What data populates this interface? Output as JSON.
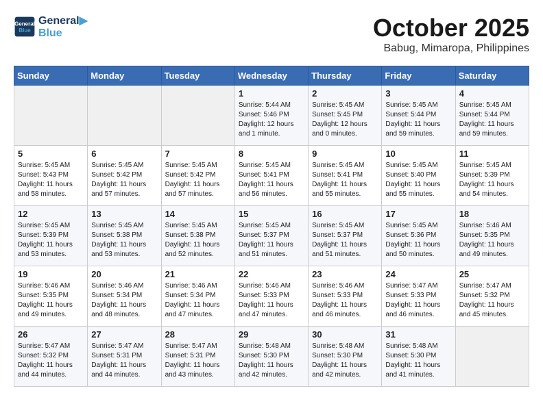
{
  "header": {
    "logo_line1": "General",
    "logo_line2": "Blue",
    "month": "October 2025",
    "location": "Babug, Mimaropa, Philippines"
  },
  "days_of_week": [
    "Sunday",
    "Monday",
    "Tuesday",
    "Wednesday",
    "Thursday",
    "Friday",
    "Saturday"
  ],
  "weeks": [
    [
      {
        "day": "",
        "text": ""
      },
      {
        "day": "",
        "text": ""
      },
      {
        "day": "",
        "text": ""
      },
      {
        "day": "1",
        "text": "Sunrise: 5:44 AM\nSunset: 5:46 PM\nDaylight: 12 hours\nand 1 minute."
      },
      {
        "day": "2",
        "text": "Sunrise: 5:45 AM\nSunset: 5:45 PM\nDaylight: 12 hours\nand 0 minutes."
      },
      {
        "day": "3",
        "text": "Sunrise: 5:45 AM\nSunset: 5:44 PM\nDaylight: 11 hours\nand 59 minutes."
      },
      {
        "day": "4",
        "text": "Sunrise: 5:45 AM\nSunset: 5:44 PM\nDaylight: 11 hours\nand 59 minutes."
      }
    ],
    [
      {
        "day": "5",
        "text": "Sunrise: 5:45 AM\nSunset: 5:43 PM\nDaylight: 11 hours\nand 58 minutes."
      },
      {
        "day": "6",
        "text": "Sunrise: 5:45 AM\nSunset: 5:42 PM\nDaylight: 11 hours\nand 57 minutes."
      },
      {
        "day": "7",
        "text": "Sunrise: 5:45 AM\nSunset: 5:42 PM\nDaylight: 11 hours\nand 57 minutes."
      },
      {
        "day": "8",
        "text": "Sunrise: 5:45 AM\nSunset: 5:41 PM\nDaylight: 11 hours\nand 56 minutes."
      },
      {
        "day": "9",
        "text": "Sunrise: 5:45 AM\nSunset: 5:41 PM\nDaylight: 11 hours\nand 55 minutes."
      },
      {
        "day": "10",
        "text": "Sunrise: 5:45 AM\nSunset: 5:40 PM\nDaylight: 11 hours\nand 55 minutes."
      },
      {
        "day": "11",
        "text": "Sunrise: 5:45 AM\nSunset: 5:39 PM\nDaylight: 11 hours\nand 54 minutes."
      }
    ],
    [
      {
        "day": "12",
        "text": "Sunrise: 5:45 AM\nSunset: 5:39 PM\nDaylight: 11 hours\nand 53 minutes."
      },
      {
        "day": "13",
        "text": "Sunrise: 5:45 AM\nSunset: 5:38 PM\nDaylight: 11 hours\nand 53 minutes."
      },
      {
        "day": "14",
        "text": "Sunrise: 5:45 AM\nSunset: 5:38 PM\nDaylight: 11 hours\nand 52 minutes."
      },
      {
        "day": "15",
        "text": "Sunrise: 5:45 AM\nSunset: 5:37 PM\nDaylight: 11 hours\nand 51 minutes."
      },
      {
        "day": "16",
        "text": "Sunrise: 5:45 AM\nSunset: 5:37 PM\nDaylight: 11 hours\nand 51 minutes."
      },
      {
        "day": "17",
        "text": "Sunrise: 5:45 AM\nSunset: 5:36 PM\nDaylight: 11 hours\nand 50 minutes."
      },
      {
        "day": "18",
        "text": "Sunrise: 5:46 AM\nSunset: 5:35 PM\nDaylight: 11 hours\nand 49 minutes."
      }
    ],
    [
      {
        "day": "19",
        "text": "Sunrise: 5:46 AM\nSunset: 5:35 PM\nDaylight: 11 hours\nand 49 minutes."
      },
      {
        "day": "20",
        "text": "Sunrise: 5:46 AM\nSunset: 5:34 PM\nDaylight: 11 hours\nand 48 minutes."
      },
      {
        "day": "21",
        "text": "Sunrise: 5:46 AM\nSunset: 5:34 PM\nDaylight: 11 hours\nand 47 minutes."
      },
      {
        "day": "22",
        "text": "Sunrise: 5:46 AM\nSunset: 5:33 PM\nDaylight: 11 hours\nand 47 minutes."
      },
      {
        "day": "23",
        "text": "Sunrise: 5:46 AM\nSunset: 5:33 PM\nDaylight: 11 hours\nand 46 minutes."
      },
      {
        "day": "24",
        "text": "Sunrise: 5:47 AM\nSunset: 5:33 PM\nDaylight: 11 hours\nand 46 minutes."
      },
      {
        "day": "25",
        "text": "Sunrise: 5:47 AM\nSunset: 5:32 PM\nDaylight: 11 hours\nand 45 minutes."
      }
    ],
    [
      {
        "day": "26",
        "text": "Sunrise: 5:47 AM\nSunset: 5:32 PM\nDaylight: 11 hours\nand 44 minutes."
      },
      {
        "day": "27",
        "text": "Sunrise: 5:47 AM\nSunset: 5:31 PM\nDaylight: 11 hours\nand 44 minutes."
      },
      {
        "day": "28",
        "text": "Sunrise: 5:47 AM\nSunset: 5:31 PM\nDaylight: 11 hours\nand 43 minutes."
      },
      {
        "day": "29",
        "text": "Sunrise: 5:48 AM\nSunset: 5:30 PM\nDaylight: 11 hours\nand 42 minutes."
      },
      {
        "day": "30",
        "text": "Sunrise: 5:48 AM\nSunset: 5:30 PM\nDaylight: 11 hours\nand 42 minutes."
      },
      {
        "day": "31",
        "text": "Sunrise: 5:48 AM\nSunset: 5:30 PM\nDaylight: 11 hours\nand 41 minutes."
      },
      {
        "day": "",
        "text": ""
      }
    ]
  ]
}
